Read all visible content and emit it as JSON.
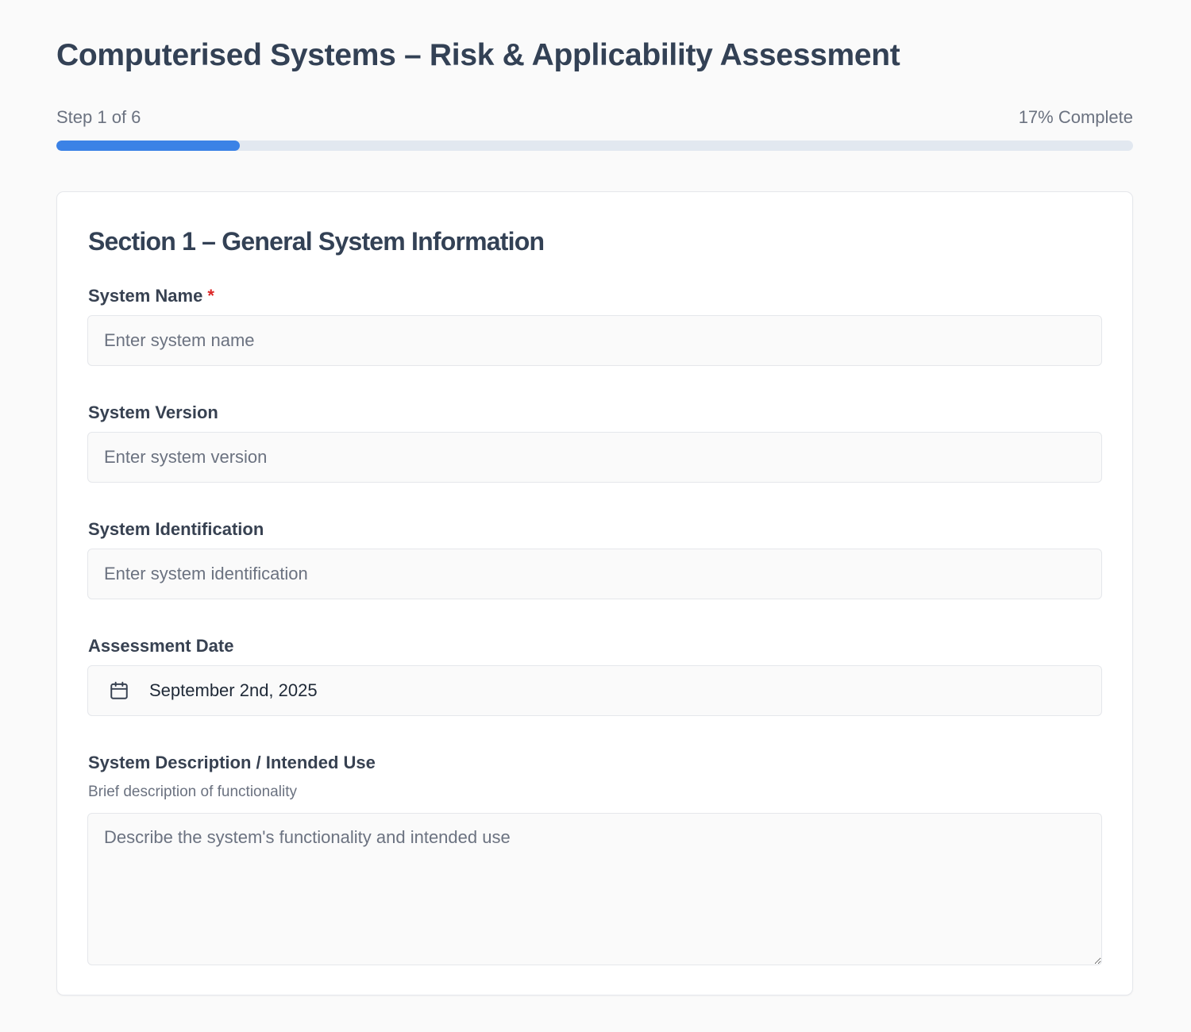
{
  "page": {
    "title": "Computerised Systems – Risk & Applicability Assessment"
  },
  "progress": {
    "step_text": "Step 1 of 6",
    "complete_text": "17% Complete",
    "current_step": 1,
    "total_steps": 6,
    "percent": 17,
    "fill_color": "#3b82e6",
    "track_color": "#e2e8f0"
  },
  "section": {
    "title": "Section 1 – General System Information",
    "fields": {
      "system_name": {
        "label": "System Name",
        "required_marker": "*",
        "placeholder": "Enter system name",
        "value": ""
      },
      "system_version": {
        "label": "System Version",
        "placeholder": "Enter system version",
        "value": ""
      },
      "system_identification": {
        "label": "System Identification",
        "placeholder": "Enter system identification",
        "value": ""
      },
      "assessment_date": {
        "label": "Assessment Date",
        "icon": "calendar-icon",
        "value": "September 2nd, 2025"
      },
      "system_description": {
        "label": "System Description / Intended Use",
        "hint": "Brief description of functionality",
        "placeholder": "Describe the system's functionality and intended use",
        "value": ""
      }
    }
  },
  "colors": {
    "required": "#dc2626",
    "heading": "#334155",
    "muted": "#6b7280"
  }
}
